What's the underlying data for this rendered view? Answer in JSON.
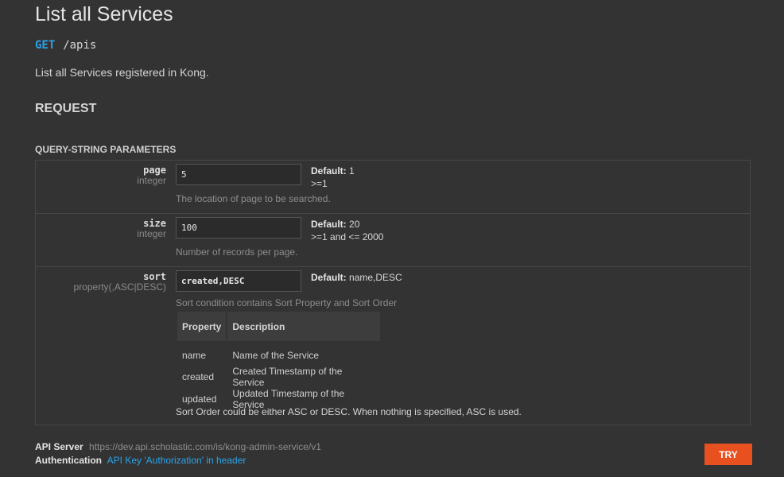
{
  "page": {
    "title": "List all Services",
    "method": "GET",
    "path": "/apis",
    "description": "List all Services registered in Kong.",
    "request_heading": "REQUEST",
    "query_heading": "QUERY-STRING PARAMETERS"
  },
  "params": [
    {
      "name": "page",
      "type": "integer",
      "value": "5",
      "default_label": "Default:",
      "default_value": "1",
      "constraint": ">=1",
      "hint": "The location of page to be searched."
    },
    {
      "name": "size",
      "type": "integer",
      "value": "100",
      "default_label": "Default:",
      "default_value": "20",
      "constraint": ">=1 and <= 2000",
      "hint": "Number of records per page."
    },
    {
      "name": "sort",
      "type": "property(,ASC|DESC)",
      "value": "created,DESC",
      "default_label": "Default:",
      "default_value": "name,DESC",
      "hint": "Sort condition contains Sort Property and Sort Order",
      "table": {
        "headers": [
          "Property",
          "Description"
        ],
        "rows": [
          [
            "name",
            "Name of the Service"
          ],
          [
            "created",
            "Created Timestamp of the Service"
          ],
          [
            "updated",
            "Updated Timestamp of the Service"
          ]
        ]
      },
      "note": "Sort Order could be either ASC or DESC. When nothing is specified, ASC is used."
    }
  ],
  "footer": {
    "server_label": "API Server",
    "server_url": "https://dev.api.scholastic.com/is/kong-admin-service/v1",
    "auth_label": "Authentication",
    "auth_value": "API Key 'Authorization' in header",
    "try_label": "TRY"
  },
  "colors": {
    "background": "#333333",
    "accent_blue": "#2aa4ea",
    "try_button": "#e8501f"
  }
}
